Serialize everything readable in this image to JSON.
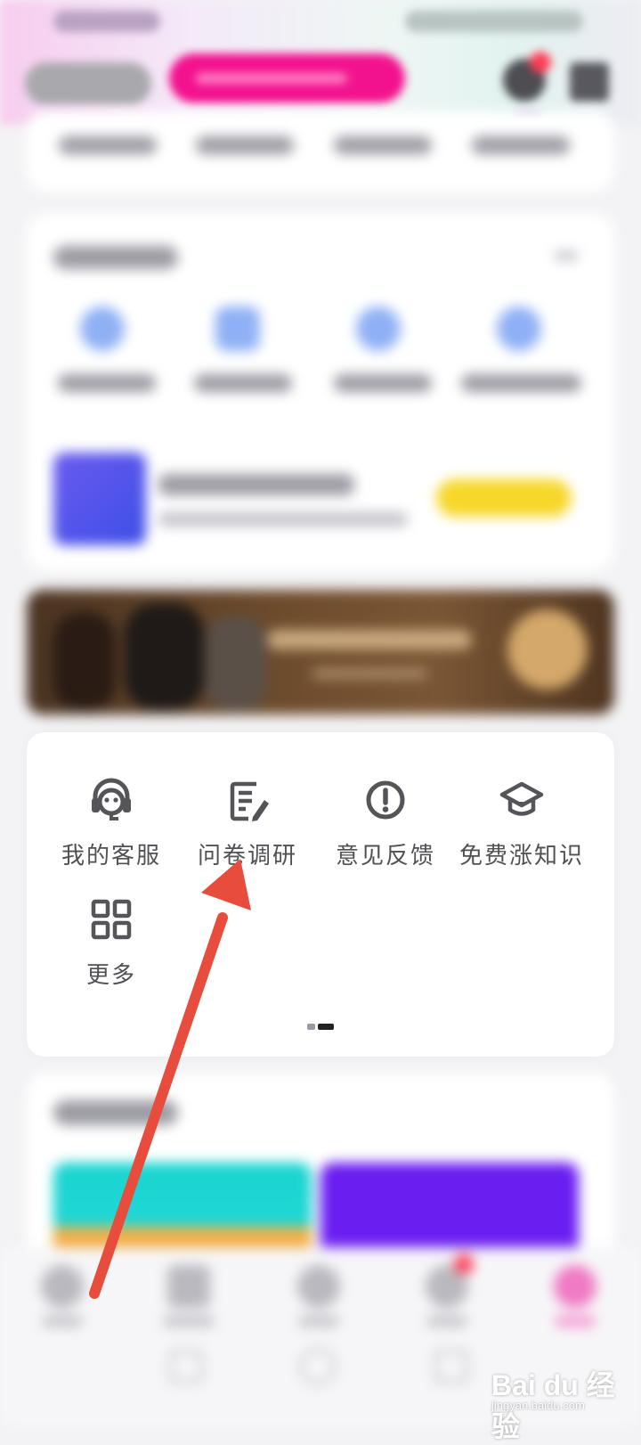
{
  "services": {
    "items": [
      {
        "label": "我的客服",
        "icon": "headset-icon"
      },
      {
        "label": "问卷调研",
        "icon": "survey-edit-icon"
      },
      {
        "label": "意见反馈",
        "icon": "exclamation-circle-icon"
      },
      {
        "label": "免费涨知识",
        "icon": "graduation-cap-icon"
      },
      {
        "label": "更多",
        "icon": "grid-icon"
      }
    ],
    "page_indicator": {
      "pages": 2,
      "active": 2
    }
  },
  "annotation": {
    "type": "red-arrow",
    "color": "#e74c3c",
    "points_to": "问卷调研"
  },
  "watermark": {
    "brand": "Bai du 经验",
    "url": "jingyan.baidu.com"
  },
  "colors": {
    "accent_pink": "#f3128e",
    "badge_red": "#ff3b55",
    "icon_gray": "#555559"
  }
}
